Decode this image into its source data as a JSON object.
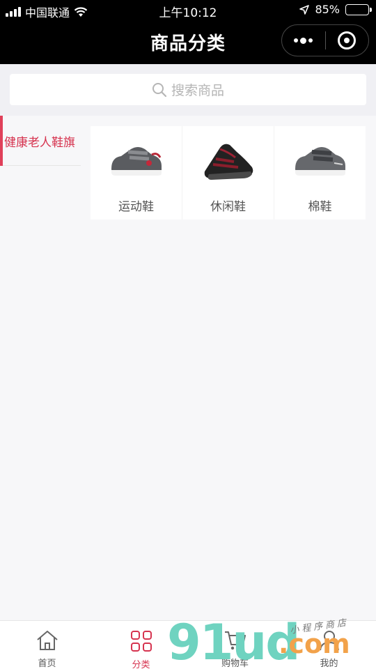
{
  "status_bar": {
    "carrier": "中国联通",
    "time": "上午10:12",
    "battery_text": "85%",
    "battery_level": 0.85
  },
  "nav": {
    "title": "商品分类"
  },
  "search": {
    "placeholder": "搜索商品"
  },
  "sidebar": {
    "items": [
      {
        "label": "健康老人鞋旗",
        "active": true
      }
    ]
  },
  "products": [
    {
      "name": "运动鞋",
      "icon": "sneaker-grey-red"
    },
    {
      "name": "休闲鞋",
      "icon": "slipon-black-red"
    },
    {
      "name": "棉鞋",
      "icon": "sneaker-grey-velcro"
    }
  ],
  "tabbar": {
    "items": [
      {
        "label": "首页",
        "icon": "home-icon"
      },
      {
        "label": "分类",
        "icon": "category-icon",
        "active": true
      },
      {
        "label": "购物车",
        "icon": "cart-icon"
      },
      {
        "label": "我的",
        "icon": "user-icon"
      }
    ]
  },
  "watermark": {
    "brand": "91ud",
    "suffix": ".com",
    "sub": "小程序商店"
  },
  "colors": {
    "accent": "#d6334f",
    "header_bg": "#000000",
    "page_bg": "#f7f7f9"
  }
}
